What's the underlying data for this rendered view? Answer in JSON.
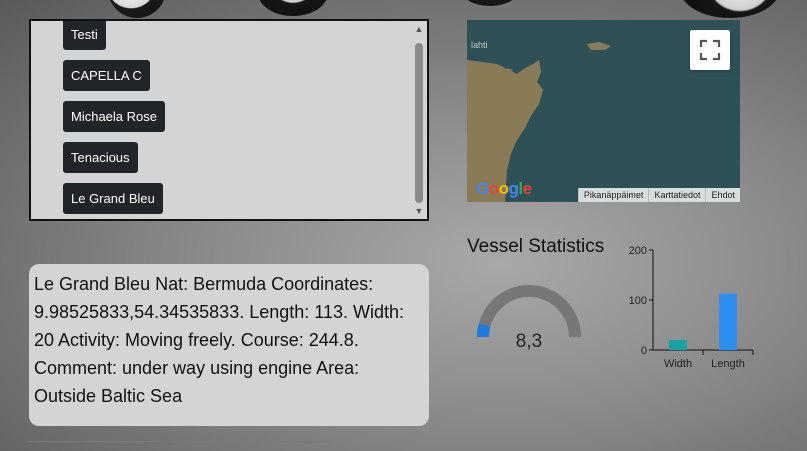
{
  "vessel_list": {
    "items": [
      "Testi",
      "CAPELLA C",
      "Michaela Rose",
      "Tenacious",
      "Le Grand Bleu"
    ]
  },
  "map": {
    "place_label": "lahti",
    "footer_links": [
      "Pikanäppäimet",
      "Karttatiedot",
      "Ehdot"
    ],
    "logo": "Google"
  },
  "info_card": {
    "text": "Le Grand Bleu Nat: Bermuda Coordinates: 9.98525833,54.34535833. Length: 113. Width: 20 Activity: Moving freely. Course: 244.8. Comment: under way using engine Area: Outside Baltic Sea"
  },
  "stats": {
    "title": "Vessel Statistics",
    "gauge_value": "8,3",
    "gauge_fraction": 0.083,
    "gauge_color": "#1e7be0",
    "gauge_track_color": "#777777"
  },
  "chart_data": {
    "type": "bar",
    "categories": [
      "Width",
      "Length"
    ],
    "values": [
      20,
      113
    ],
    "colors": [
      "#17a2a2",
      "#2d8fef"
    ],
    "ylim": [
      0,
      200
    ],
    "yticks": [
      0,
      100,
      200
    ],
    "title": "",
    "xlabel": "",
    "ylabel": ""
  }
}
